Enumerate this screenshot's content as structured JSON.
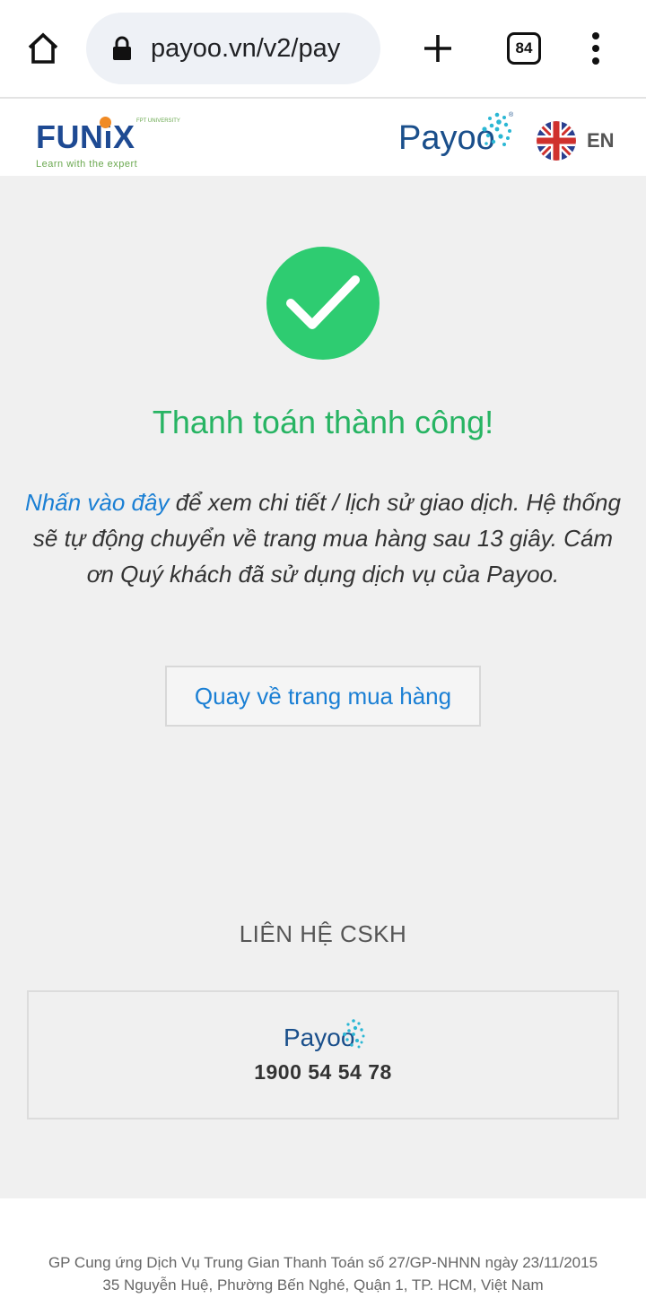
{
  "browser": {
    "url": "payoo.vn/v2/pay",
    "tab_count": "84",
    "icons": [
      "home-icon",
      "lock-icon",
      "new-tab-icon",
      "tab-switcher-icon",
      "more-vert-icon"
    ]
  },
  "header": {
    "merchant_logo_text": "FUNiX",
    "merchant_tagline": "Learn with the expert",
    "merchant_micro": "FPT UNIVERSITY",
    "payment_logo_text": "Payoo",
    "language": "EN",
    "language_flag": "uk-flag-icon"
  },
  "main": {
    "status_icon": "check-circle-icon",
    "title": "Thanh toán thành công!",
    "link_text": "Nhấn vào đây",
    "message_rest": " để xem chi tiết / lịch sử giao dịch. Hệ thống sẽ tự động chuyển về trang mua hàng sau 13 giây. Cám ơn Quý khách đã sử dụng dịch vụ của Payoo.",
    "back_button": "Quay về trang mua hàng"
  },
  "contact": {
    "heading": "LIÊN HỆ CSKH",
    "logo_text": "Payoo",
    "hotline": "1900 54 54 78"
  },
  "footer": {
    "license": "GP Cung ứng Dịch Vụ Trung Gian Thanh Toán số 27/GP-NHNN ngày 23/11/2015",
    "address": "35 Nguyễn Huệ, Phường Bến Nghé, Quận 1, TP. HCM, Việt Nam"
  },
  "colors": {
    "success_green": "#2ecc71",
    "title_green": "#27b463",
    "link_blue": "#1a7fd4",
    "payoo_navy": "#1a4f8b",
    "payoo_cyan": "#2bb7d4",
    "funix_blue": "#1e4a93",
    "funix_orange": "#f08a24"
  }
}
